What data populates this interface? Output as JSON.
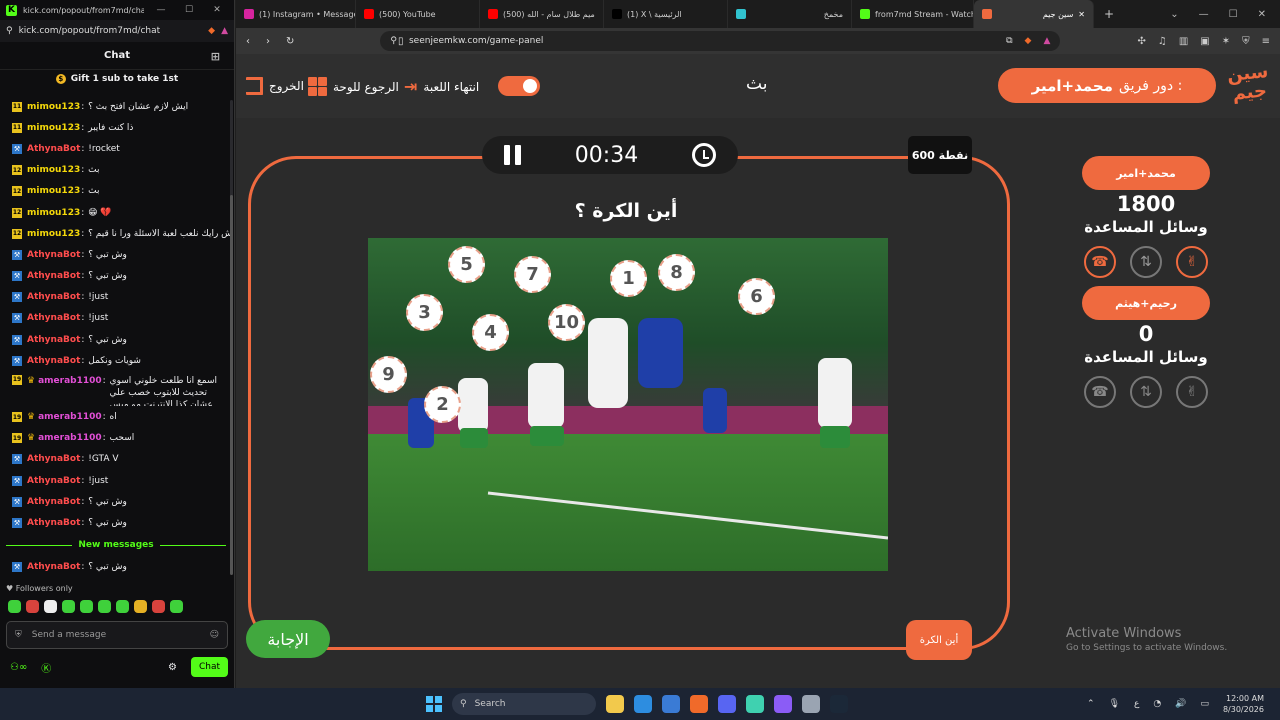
{
  "chat_window": {
    "title": "kick.com/popout/from7md/chat -...",
    "url": "kick.com/popout/from7md/chat",
    "header": "Chat",
    "pinned": "Gift 1 sub to take 1st",
    "messages": [
      {
        "user": "mimou123",
        "badge": "11",
        "kind": "mimou",
        "text": "ايش لازم عشان افتح بث ؟"
      },
      {
        "user": "mimou123",
        "badge": "11",
        "kind": "mimou",
        "text": "ذا كنت فايبر"
      },
      {
        "user": "AthynaBot",
        "badge": "bot",
        "kind": "bot",
        "text": "!rocket"
      },
      {
        "user": "mimou123",
        "badge": "12",
        "kind": "mimou",
        "text": "بث"
      },
      {
        "user": "mimou123",
        "badge": "12",
        "kind": "mimou",
        "text": "بث"
      },
      {
        "user": "mimou123",
        "badge": "12",
        "kind": "mimou",
        "text": "😁 💔"
      },
      {
        "user": "mimou123",
        "badge": "12",
        "kind": "mimou",
        "text": "وش رايك نلعب لعبة الاسئلة ورا نا قيم ؟"
      },
      {
        "user": "AthynaBot",
        "badge": "bot",
        "kind": "bot",
        "text": "وش تبي ؟"
      },
      {
        "user": "AthynaBot",
        "badge": "bot",
        "kind": "bot",
        "text": "وش تبي ؟"
      },
      {
        "user": "AthynaBot",
        "badge": "bot",
        "kind": "bot",
        "text": "!just"
      },
      {
        "user": "AthynaBot",
        "badge": "bot",
        "kind": "bot",
        "text": "!just"
      },
      {
        "user": "AthynaBot",
        "badge": "bot",
        "kind": "bot",
        "text": "وش تبي ؟"
      },
      {
        "user": "AthynaBot",
        "badge": "bot",
        "kind": "bot",
        "text": "شويات ونكمل"
      },
      {
        "user": "amerab1100",
        "badge": "19",
        "kind": "amer",
        "text": "اسمع انا طلعت خلوني اسوي تحديث للابتوب خصب علي عشان كذا الانترنت مو ميس",
        "two": true
      },
      {
        "user": "amerab1100",
        "badge": "19",
        "kind": "amer",
        "text": "اه"
      },
      {
        "user": "amerab1100",
        "badge": "19",
        "kind": "amer",
        "text": "اسحب"
      },
      {
        "user": "AthynaBot",
        "badge": "bot",
        "kind": "bot",
        "text": "!GTA V"
      },
      {
        "user": "AthynaBot",
        "badge": "bot",
        "kind": "bot",
        "text": "!just"
      },
      {
        "user": "AthynaBot",
        "badge": "bot",
        "kind": "bot",
        "text": "وش تبي ؟"
      },
      {
        "user": "AthynaBot",
        "badge": "bot",
        "kind": "bot",
        "text": "وش تبي ؟"
      }
    ],
    "new_messages_label": "New messages",
    "last_message": {
      "user": "AthynaBot",
      "text": "وش تبي ؟"
    },
    "followers_only": "Followers only",
    "send_placeholder": "Send a message",
    "chat_button": "Chat"
  },
  "browser": {
    "tabs": [
      {
        "label": "(1) Instagram • Messages",
        "color": "#d6249f"
      },
      {
        "label": "(500) YouTube",
        "color": "#ff0000"
      },
      {
        "label": "(500) ميم طلال سام - الله",
        "color": "#ff0000"
      },
      {
        "label": "(1) X \\ الرئيسية",
        "color": "#000000"
      },
      {
        "label": "مخمخ",
        "color": "#31c3cf"
      },
      {
        "label": "from7md Stream - Watch",
        "color": "#53fc18"
      },
      {
        "label": "سين جيم",
        "color": "#ef6a3f"
      }
    ],
    "url": "seenjeemkw.com/game-panel"
  },
  "game": {
    "exit_label": "الخروج",
    "back_label": "الرجوع للوحة",
    "end_label": "انتهاء اللعبة",
    "title": "بث",
    "turn_label": "دور فريق :",
    "turn_team": "محمد+امير",
    "logo_text": "سين جيم",
    "timer": "00:34",
    "points": "600 نقطة",
    "question": "أين الكرة ؟",
    "balls": [
      "1",
      "2",
      "3",
      "4",
      "5",
      "6",
      "7",
      "8",
      "9",
      "10"
    ],
    "answer_button": "الإجابة",
    "where_button": "أين الكرة",
    "teams": [
      {
        "name": "محمد+امير",
        "score": "1800",
        "helpers_label": "وسائل المساعدة"
      },
      {
        "name": "رحيم+هيثم",
        "score": "0",
        "helpers_label": "وسائل المساعدة"
      }
    ],
    "colors": {
      "accent": "#ef6a3f",
      "answer": "#41a83e"
    }
  },
  "watermark": {
    "line1": "Activate Windows",
    "line2": "Go to Settings to activate Windows."
  },
  "taskbar": {
    "search_placeholder": "Search",
    "time": "12:00 AM",
    "date": "8/30/2026"
  }
}
